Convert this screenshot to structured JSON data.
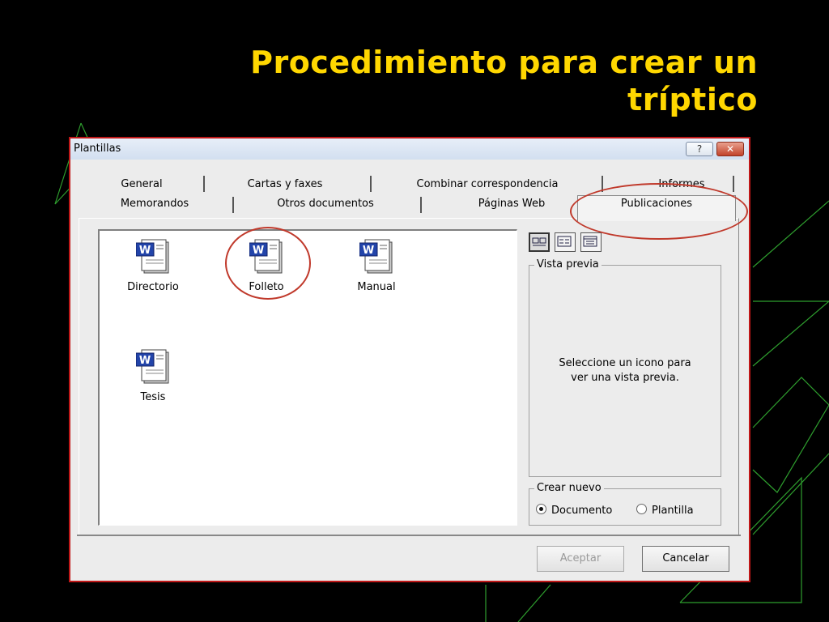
{
  "slide": {
    "title_line1": "Procedimiento para crear un",
    "title_line2": "tríptico"
  },
  "dialog": {
    "title": "Plantillas",
    "help_label": "?",
    "close_label": "✕",
    "tabs_row1": [
      "General",
      "Cartas y faxes",
      "Combinar correspondencia",
      "Informes"
    ],
    "tabs_row2": [
      "Memorandos",
      "Otros documentos",
      "Páginas Web",
      "Publicaciones"
    ],
    "active_tab": "Publicaciones",
    "templates": [
      "Directorio",
      "Folleto",
      "Manual",
      "Tesis"
    ],
    "preview_legend": "Vista previa",
    "preview_line1": "Seleccione un icono para",
    "preview_line2": "ver una vista previa.",
    "create_legend": "Crear nuevo",
    "radio_document": "Documento",
    "radio_template": "Plantilla",
    "selected_radio": "Documento",
    "ok_label": "Aceptar",
    "cancel_label": "Cancelar"
  },
  "icons": {
    "template_icon": "word-document-icon",
    "view_icons": [
      "large-icons-view-icon",
      "list-view-icon",
      "details-view-icon"
    ]
  },
  "colors": {
    "title": "#ffd700",
    "background": "#000000",
    "highlight": "#c0392b",
    "deco_lines": "#2e9e2e"
  }
}
